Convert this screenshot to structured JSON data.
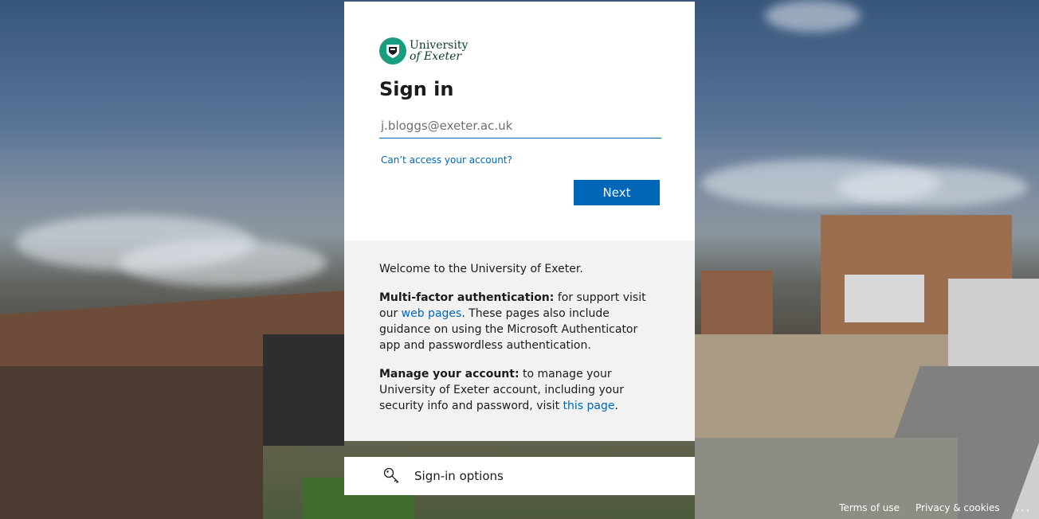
{
  "logo": {
    "line1": "University",
    "line2": "of Exeter"
  },
  "signin": {
    "title": "Sign in",
    "email_placeholder": "j.bloggs@exeter.ac.uk",
    "cant_access": "Can’t access your account?",
    "next_label": "Next"
  },
  "info": {
    "welcome": "Welcome to the University of Exeter.",
    "mfa_heading": "Multi-factor authentication:",
    "mfa_text1": " for support visit our ",
    "mfa_link": "web pages",
    "mfa_text2": ". These pages also include guidance on using the Microsoft Authenticator app and passwordless authentication.",
    "manage_heading": "Manage your account:",
    "manage_text1": " to manage your University of Exeter account, including your security info and password, visit ",
    "manage_link": "this page",
    "manage_text2": "."
  },
  "sign_in_options": {
    "label": "Sign-in options",
    "icon": "key-icon"
  },
  "footer": {
    "terms": "Terms of use",
    "privacy": "Privacy & cookies",
    "more": "..."
  },
  "colors": {
    "accent": "#0067b8",
    "brand": "#1a9d7e"
  }
}
